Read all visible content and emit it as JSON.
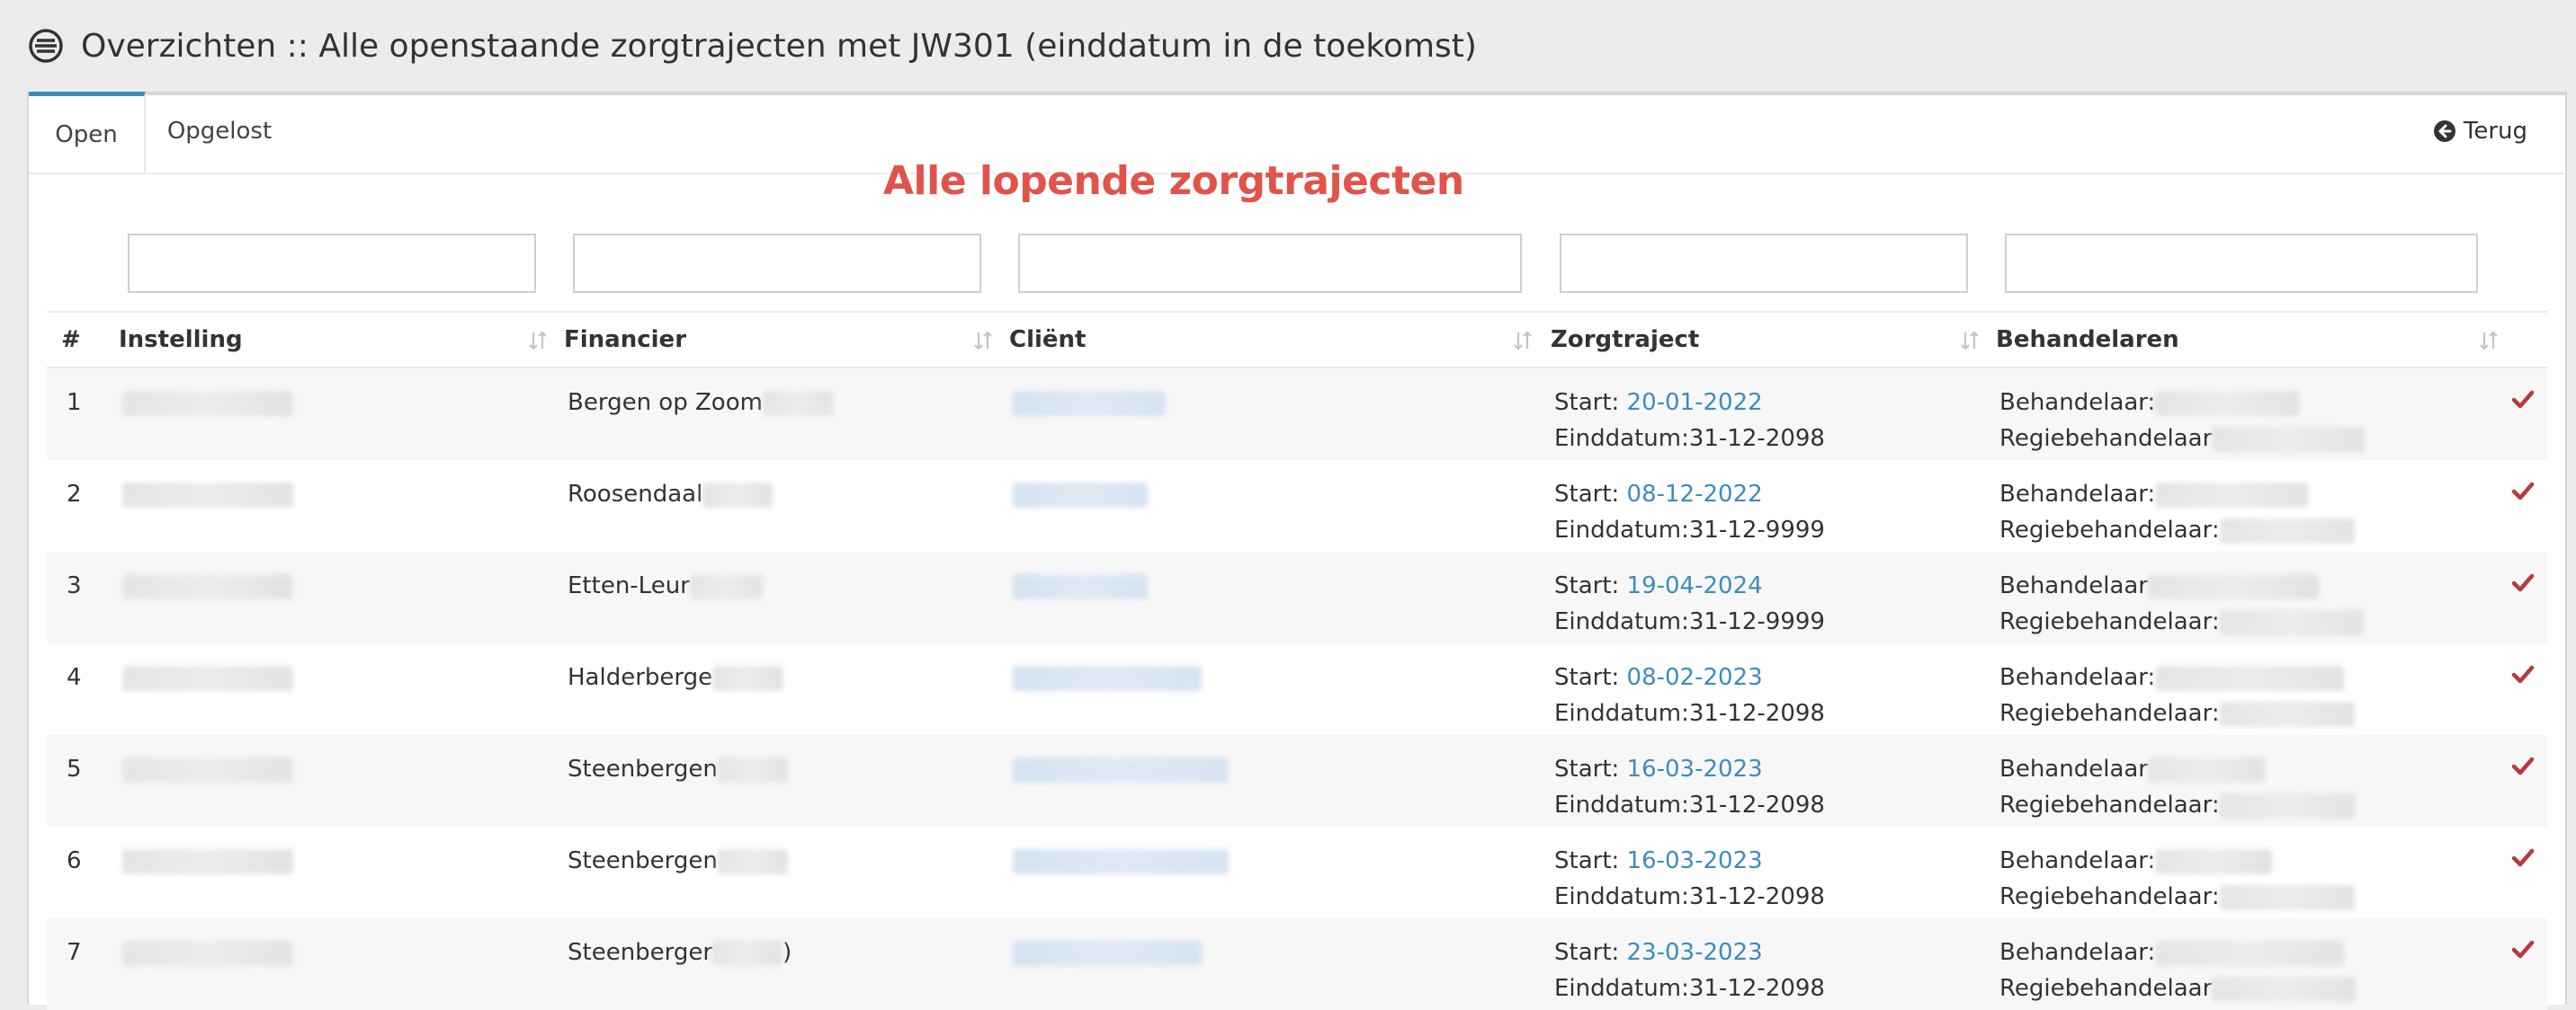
{
  "header": {
    "title": "Overzichten :: Alle openstaande zorgtrajecten met JW301 (einddatum in de toekomst)"
  },
  "tabs": {
    "open": "Open",
    "solved": "Opgelost"
  },
  "back_label": "Terug",
  "annotation": "Alle lopende zorgtrajecten",
  "columns": {
    "num": "#",
    "institution": "Instelling",
    "financier": "Financier",
    "client": "Cliënt",
    "trajectory": "Zorgtraject",
    "practitioners": "Behandelaren"
  },
  "labels": {
    "start": "Start: ",
    "end": "Einddatum:",
    "practitioner": "Behandelaar:",
    "director": "Regiebehandelaar:"
  },
  "colors": {
    "accent": "#3c8dbc",
    "check": "#b7393e",
    "annotation": "#e0544b"
  },
  "rows": [
    {
      "num": "1",
      "financier": "Bergen op Zoom",
      "start": "20-01-2022",
      "end": "31-12-2098",
      "practitioner_label": "Behandelaar:",
      "director_label": "Regiebehandelaar"
    },
    {
      "num": "2",
      "financier": "Roosendaal",
      "start": "08-12-2022",
      "end": "31-12-9999",
      "practitioner_label": "Behandelaar:",
      "director_label": "Regiebehandelaar:"
    },
    {
      "num": "3",
      "financier": "Etten-Leur",
      "start": "19-04-2024",
      "end": "31-12-9999",
      "practitioner_label": "Behandelaar",
      "director_label": "Regiebehandelaar:"
    },
    {
      "num": "4",
      "financier": "Halderberge",
      "start": "08-02-2023",
      "end": "31-12-2098",
      "practitioner_label": "Behandelaar:",
      "director_label": "Regiebehandelaar:"
    },
    {
      "num": "5",
      "financier": "Steenbergen",
      "start": "16-03-2023",
      "end": "31-12-2098",
      "practitioner_label": "Behandelaar",
      "director_label": "Regiebehandelaar:"
    },
    {
      "num": "6",
      "financier": "Steenbergen",
      "start": "16-03-2023",
      "end": "31-12-2098",
      "practitioner_label": "Behandelaar:",
      "director_label": "Regiebehandelaar:"
    },
    {
      "num": "7",
      "financier": "Steenberger",
      "financier_suffix": ")",
      "start": "23-03-2023",
      "end": "31-12-2098",
      "practitioner_label": "Behandelaar:",
      "director_label": "Regiebehandelaar"
    }
  ]
}
